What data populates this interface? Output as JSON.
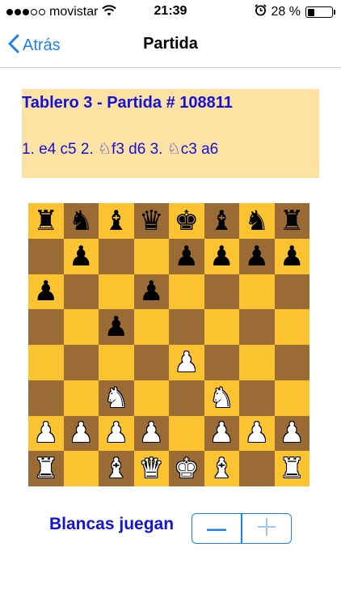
{
  "status_bar": {
    "carrier": "movistar",
    "signal_strength": 3,
    "signal_max": 5,
    "time": "21:39",
    "battery_text": "28 %",
    "battery_level": 0.28,
    "icons": [
      "signal-dots-icon",
      "wifi-icon",
      "alarm-clock-icon",
      "battery-icon"
    ]
  },
  "nav": {
    "back_label": "Atrás",
    "title": "Partida",
    "accent_color": "#1b82f3"
  },
  "game": {
    "title": "Tablero 3 - Partida # 108811",
    "moves_text": "1.  e4   c5  2.  ♘f3   d6  3.  ♘c3   a6",
    "panel_color": "#fde2a3",
    "text_color": "#1212d8"
  },
  "board": {
    "light_color": "#fcc330",
    "dark_color": "#9b6b35",
    "ranks": [
      [
        "bR",
        "bN",
        "bB",
        "bQ",
        "bK",
        "bB",
        "bN",
        "bR"
      ],
      [
        "",
        "bP",
        "",
        "",
        "bP",
        "bP",
        "bP",
        "bP"
      ],
      [
        "bP",
        "",
        "",
        "bP",
        "",
        "",
        "",
        ""
      ],
      [
        "",
        "",
        "bP",
        "",
        "",
        "",
        "",
        ""
      ],
      [
        "",
        "",
        "",
        "",
        "wP",
        "",
        "",
        ""
      ],
      [
        "",
        "",
        "wN",
        "",
        "",
        "wN",
        "",
        ""
      ],
      [
        "wP",
        "wP",
        "wP",
        "wP",
        "",
        "wP",
        "wP",
        "wP"
      ],
      [
        "wR",
        "",
        "wB",
        "wQ",
        "wK",
        "wB",
        "",
        "wR"
      ]
    ]
  },
  "controls": {
    "turn_label": "Blancas juegan",
    "stepper_minus_icon": "minus-icon",
    "stepper_plus_icon": "plus-icon"
  }
}
